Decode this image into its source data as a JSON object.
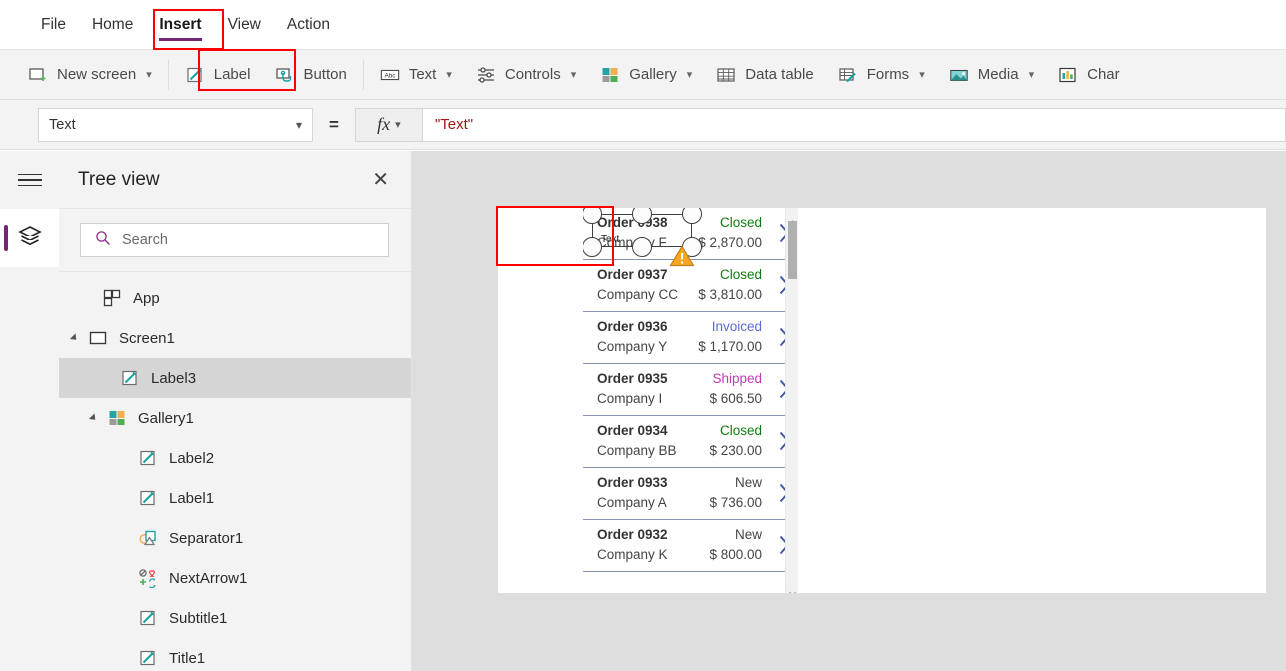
{
  "menu": {
    "items": [
      {
        "label": "File",
        "active": false
      },
      {
        "label": "Home",
        "active": false
      },
      {
        "label": "Insert",
        "active": true
      },
      {
        "label": "View",
        "active": false
      },
      {
        "label": "Action",
        "active": false
      }
    ],
    "active_accent_color": "#742774",
    "highlight_color": "#ff0000"
  },
  "ribbon": {
    "items": [
      {
        "label": "New screen",
        "icon": "new-screen-icon",
        "caret": true
      },
      {
        "label": "Label",
        "icon": "label-icon",
        "caret": false
      },
      {
        "label": "Button",
        "icon": "button-icon",
        "caret": false
      },
      {
        "label": "Text",
        "icon": "text-abc-icon",
        "caret": true
      },
      {
        "label": "Controls",
        "icon": "controls-sliders-icon",
        "caret": true
      },
      {
        "label": "Gallery",
        "icon": "gallery-grid-icon",
        "caret": true
      },
      {
        "label": "Data table",
        "icon": "data-table-icon",
        "caret": false
      },
      {
        "label": "Forms",
        "icon": "forms-icon",
        "caret": true
      },
      {
        "label": "Media",
        "icon": "media-image-icon",
        "caret": true
      },
      {
        "label": "Char",
        "icon": "charts-bar-icon",
        "caret": false
      }
    ]
  },
  "formula_bar": {
    "property": "Text",
    "equals": "=",
    "fx_label": "fx",
    "formula": "\"Text\"",
    "formula_color": "#a31515"
  },
  "rail": {
    "hamburger": "hamburger-menu-icon",
    "active_button": "tree-view-layers-icon"
  },
  "tree_view": {
    "title": "Tree view",
    "close": "✕",
    "search_placeholder": "Search",
    "search_value": "",
    "items": [
      {
        "label": "App",
        "icon": "app-icon",
        "indent": 0,
        "caret": "none",
        "selected": false
      },
      {
        "label": "Screen1",
        "icon": "screen-icon",
        "indent": 0,
        "caret": "expanded",
        "selected": false
      },
      {
        "label": "Label3",
        "icon": "label-pencil-icon",
        "indent": 1,
        "caret": "none",
        "selected": true
      },
      {
        "label": "Gallery1",
        "icon": "gallery-grid-icon",
        "indent": 1,
        "caret": "expanded",
        "selected": false
      },
      {
        "label": "Label2",
        "icon": "label-pencil-icon",
        "indent": 2,
        "caret": "none",
        "selected": false
      },
      {
        "label": "Label1",
        "icon": "label-pencil-icon",
        "indent": 2,
        "caret": "none",
        "selected": false
      },
      {
        "label": "Separator1",
        "icon": "separator-shapes-icon",
        "indent": 2,
        "caret": "none",
        "selected": false
      },
      {
        "label": "NextArrow1",
        "icon": "next-arrow-icons-icon",
        "indent": 2,
        "caret": "none",
        "selected": false
      },
      {
        "label": "Subtitle1",
        "icon": "label-pencil-icon",
        "indent": 2,
        "caret": "none",
        "selected": false
      },
      {
        "label": "Title1",
        "icon": "label-pencil-icon",
        "indent": 2,
        "caret": "none",
        "selected": false
      }
    ]
  },
  "canvas": {
    "selected_control_text": "Text",
    "warning_icon": "warning-triangle-icon",
    "gallery": {
      "items": [
        {
          "order": "Order 0938",
          "company": "Company F",
          "status": "Closed",
          "status_color": "#107c10",
          "amount": "$ 2,870.00"
        },
        {
          "order": "Order 0937",
          "company": "Company CC",
          "status": "Closed",
          "status_color": "#107c10",
          "amount": "$ 3,810.00"
        },
        {
          "order": "Order 0936",
          "company": "Company Y",
          "status": "Invoiced",
          "status_color": "#5b6bd6",
          "amount": "$ 1,170.00"
        },
        {
          "order": "Order 0935",
          "company": "Company I",
          "status": "Shipped",
          "status_color": "#c239b3",
          "amount": "$ 606.50"
        },
        {
          "order": "Order 0934",
          "company": "Company BB",
          "status": "Closed",
          "status_color": "#107c10",
          "amount": "$ 230.00"
        },
        {
          "order": "Order 0933",
          "company": "Company A",
          "status": "New",
          "status_color": "#444444",
          "amount": "$ 736.00"
        },
        {
          "order": "Order 0932",
          "company": "Company K",
          "status": "New",
          "status_color": "#444444",
          "amount": "$ 800.00"
        }
      ],
      "chevron_color": "#4257a8",
      "divider_color": "#8a93b5"
    }
  }
}
